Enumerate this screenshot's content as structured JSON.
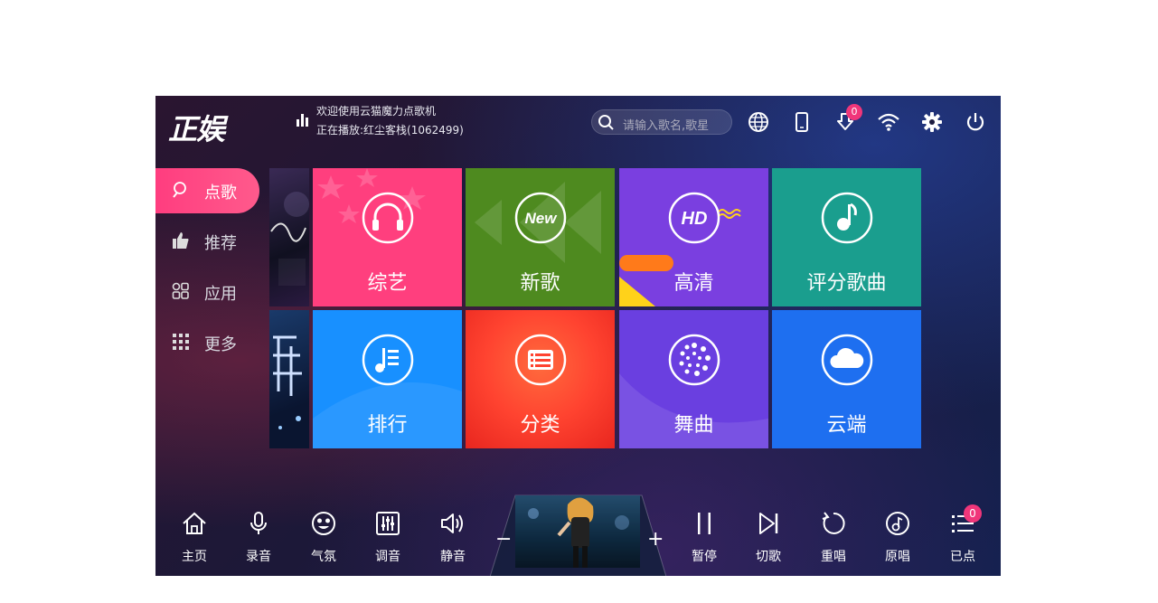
{
  "header": {
    "logo": "正娱",
    "welcome": "欢迎使用云猫魔力点歌机",
    "now_playing": "正在播放:红尘客栈(1062499)",
    "search_placeholder": "请输入歌名,歌星",
    "download_badge": "0",
    "icons": [
      "globe-icon",
      "phone-icon",
      "download-icon",
      "wifi-icon",
      "settings-icon",
      "power-icon"
    ]
  },
  "sidebar": {
    "items": [
      {
        "label": "点歌",
        "icon": "mic-search-icon",
        "active": true
      },
      {
        "label": "推荐",
        "icon": "thumbs-up-icon",
        "active": false
      },
      {
        "label": "应用",
        "icon": "apps-icon",
        "active": false
      },
      {
        "label": "更多",
        "icon": "grid-dots-icon",
        "active": false
      }
    ]
  },
  "tiles": [
    {
      "label": "综艺",
      "icon": "headphones-icon",
      "color": "#ff3f7e"
    },
    {
      "label": "新歌",
      "icon": "new-icon",
      "color": "#4e8a1f"
    },
    {
      "label": "高清",
      "icon": "hd-icon",
      "color": "#7a3fe0"
    },
    {
      "label": "评分歌曲",
      "icon": "music-note-icon",
      "color": "#1a9e8e"
    },
    {
      "label": "排行",
      "icon": "chart-list-icon",
      "color": "#1890ff"
    },
    {
      "label": "分类",
      "icon": "category-icon",
      "color": "#ff4a2e"
    },
    {
      "label": "舞曲",
      "icon": "dance-icon",
      "color": "#6a3fe0"
    },
    {
      "label": "云端",
      "icon": "cloud-icon",
      "color": "#1e6ff0"
    }
  ],
  "new_icon_text": "New",
  "hd_icon_text": "HD",
  "bottom_bar": {
    "left": [
      {
        "label": "主页",
        "icon": "home-icon"
      },
      {
        "label": "录音",
        "icon": "microphone-icon"
      },
      {
        "label": "气氛",
        "icon": "smiley-icon"
      },
      {
        "label": "调音",
        "icon": "mixer-icon"
      },
      {
        "label": "静音",
        "icon": "speaker-icon"
      }
    ],
    "vol_down": "−",
    "vol_up": "+",
    "right": [
      {
        "label": "暂停",
        "icon": "pause-icon"
      },
      {
        "label": "切歌",
        "icon": "next-icon"
      },
      {
        "label": "重唱",
        "icon": "replay-icon"
      },
      {
        "label": "原唱",
        "icon": "vocal-icon"
      },
      {
        "label": "已点",
        "icon": "queue-icon"
      }
    ],
    "queue_badge": "0"
  }
}
